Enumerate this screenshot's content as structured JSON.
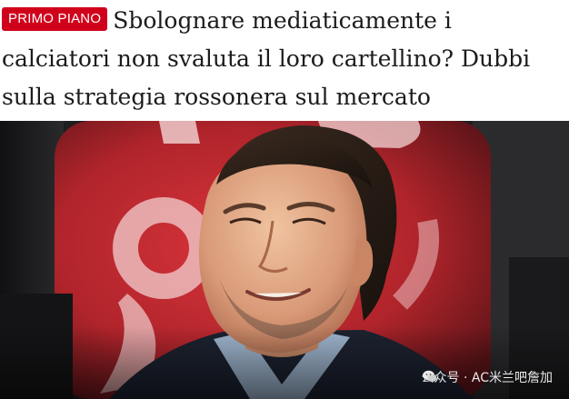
{
  "article": {
    "badge": "PRIMO PIANO",
    "title": "Sbolognare mediaticamente i calciatori non svaluta il loro cartellino? Dubbi sulla strategia rossonera sul mercato"
  },
  "photo": {
    "subject": "man-portrait",
    "background_accent": "#c0262d"
  },
  "watermark": {
    "icon": "wechat-icon",
    "text": "公众号 · AC米兰吧詹加"
  },
  "colors": {
    "badge_bg": "#d0021b",
    "title_text": "#1b1b1b"
  }
}
